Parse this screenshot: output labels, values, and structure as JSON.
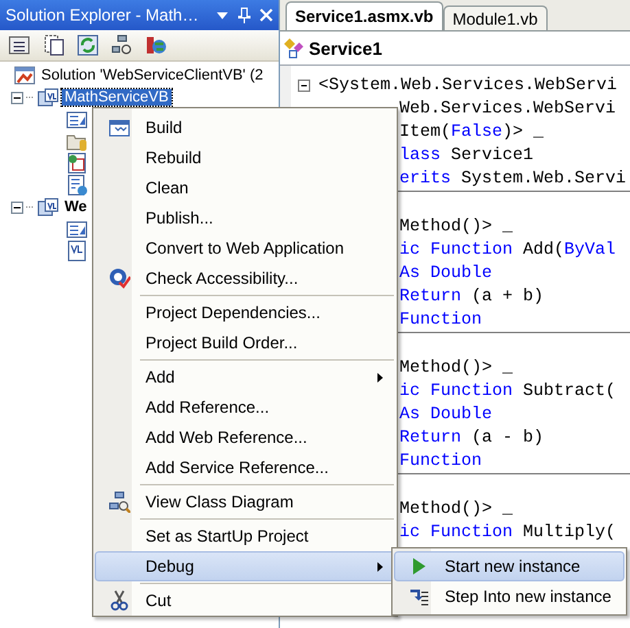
{
  "explorer": {
    "title": "Solution Explorer - Math…",
    "tree": [
      {
        "label": "Solution 'WebServiceClientVB' (2",
        "kind": "solution",
        "bold": false,
        "selected": false,
        "children": [
          {
            "label": "MathServiceVB",
            "kind": "project",
            "bold": false,
            "selected": true,
            "expanded": true,
            "children": [
              {
                "kind": "references"
              },
              {
                "kind": "folder"
              },
              {
                "kind": "web-page"
              },
              {
                "kind": "web-config"
              }
            ]
          },
          {
            "label": "We",
            "kind": "project",
            "bold": true,
            "selected": false,
            "expanded": true,
            "children": [
              {
                "kind": "references"
              },
              {
                "kind": "vb-file"
              }
            ]
          }
        ]
      }
    ]
  },
  "editor": {
    "tabs": [
      {
        "label": "Service1.asmx.vb",
        "selected": true
      },
      {
        "label": "Module1.vb",
        "selected": false
      }
    ],
    "nav": "Service1",
    "blocks": [
      {
        "lines": [
          {
            "kind": "full",
            "segments": [
              {
                "text": "<System.Web.Services.WebServi",
                "kind": "plain"
              }
            ]
          },
          {
            "kind": "covered",
            "segments": [
              {
                "text": "Web.Services.WebServi",
                "kind": "plain"
              }
            ]
          },
          {
            "kind": "covered",
            "segments": [
              {
                "text": "Item(",
                "kind": "plain"
              },
              {
                "text": "False",
                "kind": "keyword"
              },
              {
                "text": ")> _",
                "kind": "plain"
              }
            ]
          },
          {
            "kind": "covered",
            "segments": [
              {
                "text": "lass",
                "kind": "keyword"
              },
              {
                "text": " Service1",
                "kind": "plain"
              }
            ]
          },
          {
            "kind": "covered",
            "segments": [
              {
                "text": "erits",
                "kind": "keyword"
              },
              {
                "text": " System.Web.Servi",
                "kind": "plain"
              }
            ]
          }
        ]
      },
      {
        "lines": [
          {
            "kind": "covered",
            "segments": [
              {
                "text": "Method()> _",
                "kind": "plain"
              }
            ]
          },
          {
            "kind": "covered",
            "segments": [
              {
                "text": "ic Function",
                "kind": "keyword"
              },
              {
                "text": " Add(",
                "kind": "plain"
              },
              {
                "text": "ByVal",
                "kind": "keyword"
              }
            ]
          },
          {
            "kind": "covered",
            "segments": [
              {
                "text": "As Double",
                "kind": "keyword"
              }
            ]
          },
          {
            "kind": "covered",
            "segments": [
              {
                "text": "Return",
                "kind": "keyword"
              },
              {
                "text": " (a + b)",
                "kind": "plain"
              }
            ]
          },
          {
            "kind": "covered",
            "segments": [
              {
                "text": "Function",
                "kind": "keyword"
              }
            ]
          }
        ]
      },
      {
        "lines": [
          {
            "kind": "covered",
            "segments": [
              {
                "text": "Method()> _",
                "kind": "plain"
              }
            ]
          },
          {
            "kind": "covered",
            "segments": [
              {
                "text": "ic Function",
                "kind": "keyword"
              },
              {
                "text": " Subtract(",
                "kind": "plain"
              }
            ]
          },
          {
            "kind": "covered",
            "segments": [
              {
                "text": "As Double",
                "kind": "keyword"
              }
            ]
          },
          {
            "kind": "covered",
            "segments": [
              {
                "text": "Return",
                "kind": "keyword"
              },
              {
                "text": " (a - b)",
                "kind": "plain"
              }
            ]
          },
          {
            "kind": "covered",
            "segments": [
              {
                "text": "Function",
                "kind": "keyword"
              }
            ]
          }
        ]
      },
      {
        "lines": [
          {
            "kind": "covered",
            "segments": [
              {
                "text": "Method()> _",
                "kind": "plain"
              }
            ]
          },
          {
            "kind": "covered",
            "segments": [
              {
                "text": "ic Function",
                "kind": "keyword"
              },
              {
                "text": " Multiply(",
                "kind": "plain"
              }
            ]
          }
        ]
      }
    ]
  },
  "context_menu": {
    "items": [
      {
        "kind": "command",
        "label": "Build",
        "submenu": false,
        "selected": false
      },
      {
        "kind": "command",
        "label": "Rebuild",
        "submenu": false,
        "selected": false
      },
      {
        "kind": "command",
        "label": "Clean",
        "submenu": false,
        "selected": false
      },
      {
        "kind": "command",
        "label": "Publish...",
        "submenu": false,
        "selected": false
      },
      {
        "kind": "command",
        "label": "Convert to Web Application",
        "submenu": false,
        "selected": false
      },
      {
        "kind": "command",
        "label": "Check Accessibility...",
        "submenu": false,
        "selected": false
      },
      {
        "kind": "separator"
      },
      {
        "kind": "command",
        "label": "Project Dependencies...",
        "submenu": false,
        "selected": false
      },
      {
        "kind": "command",
        "label": "Project Build Order...",
        "submenu": false,
        "selected": false
      },
      {
        "kind": "separator"
      },
      {
        "kind": "command",
        "label": "Add",
        "submenu": true,
        "selected": false
      },
      {
        "kind": "command",
        "label": "Add Reference...",
        "submenu": false,
        "selected": false
      },
      {
        "kind": "command",
        "label": "Add Web Reference...",
        "submenu": false,
        "selected": false
      },
      {
        "kind": "command",
        "label": "Add Service Reference...",
        "submenu": false,
        "selected": false
      },
      {
        "kind": "separator"
      },
      {
        "kind": "command",
        "label": "View Class Diagram",
        "submenu": false,
        "selected": false
      },
      {
        "kind": "separator"
      },
      {
        "kind": "command",
        "label": "Set as StartUp Project",
        "submenu": false,
        "selected": false
      },
      {
        "kind": "command",
        "label": "Debug",
        "submenu": true,
        "selected": true
      },
      {
        "kind": "separator"
      },
      {
        "kind": "command",
        "label": "Cut",
        "submenu": false,
        "selected": false
      }
    ],
    "submenu": [
      {
        "label": "Start new instance",
        "selected": true
      },
      {
        "label": "Step Into new instance",
        "selected": false
      }
    ]
  }
}
